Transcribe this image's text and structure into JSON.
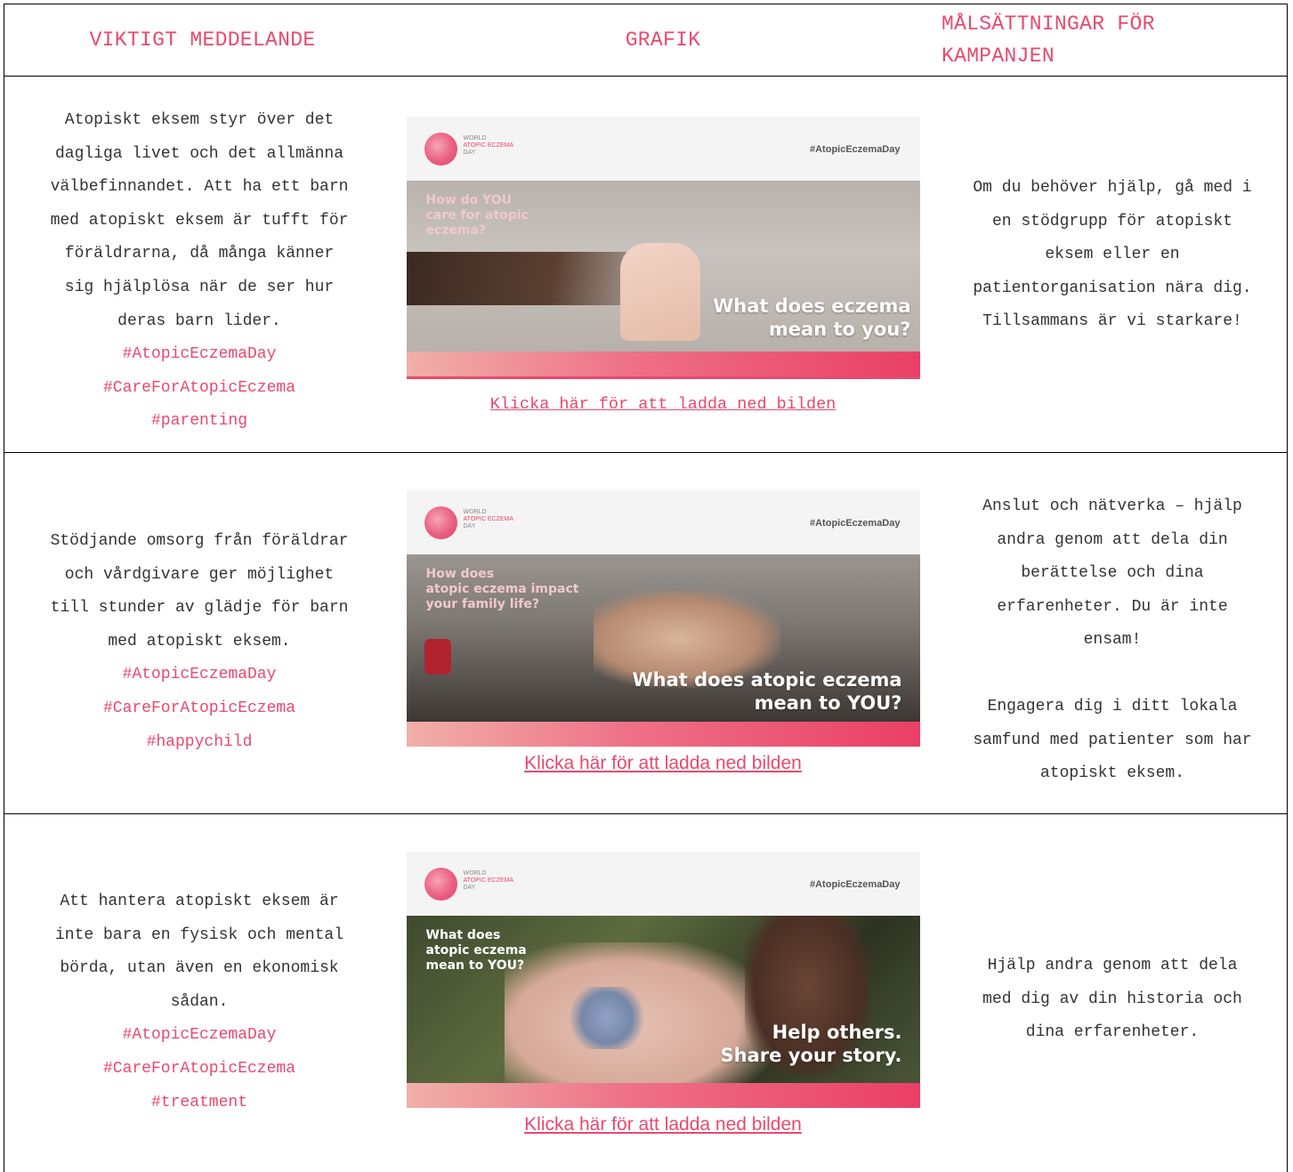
{
  "header": {
    "col1": "VIKTIGT MEDDELANDE",
    "col2": "GRAFIK",
    "col3_line1": "MÅLSÄTTNINGAR FÖR",
    "col3_line2": "KAMPANJEN"
  },
  "rows": [
    {
      "message_lines": [
        "Atopiskt eksem styr över det",
        "dagliga livet och det allmänna",
        "välbefinnandet. Att ha ett barn",
        "med atopiskt eksem är tufft för",
        "föräldrarna, då många känner",
        "sig hjälplösa när de ser hur",
        "deras barn lider."
      ],
      "hashtags": [
        "#AtopicEczemaDay",
        "#CareForAtopicEczema",
        "#parenting"
      ],
      "graphic": {
        "logo_text": [
          "WORLD",
          "ATOPIC ECZEMA",
          "DAY"
        ],
        "hashtag": "#AtopicEczemaDay",
        "question": "How do YOU\ncare for atopic\neczema?",
        "headline": "What does eczema\nmean to you?"
      },
      "link": "Klicka här för att ladda ned bilden",
      "goal_lines": [
        "Om du behöver hjälp, gå med i",
        "en stödgrupp för atopiskt",
        "eksem eller en",
        "patientorganisation nära dig.",
        "Tillsammans är vi starkare!"
      ]
    },
    {
      "message_lines": [
        "Stödjande omsorg från föräldrar",
        "och vårdgivare ger möjlighet",
        "till stunder av glädje för barn",
        "med atopiskt eksem."
      ],
      "hashtags": [
        "#AtopicEczemaDay",
        "#CareForAtopicEczema",
        "#happychild"
      ],
      "graphic": {
        "logo_text": [
          "WORLD",
          "ATOPIC ECZEMA",
          "DAY"
        ],
        "hashtag": "#AtopicEczemaDay",
        "question": "How does\natopic eczema impact\nyour family life?",
        "headline": "What does atopic eczema\nmean to YOU?"
      },
      "link": "Klicka här för att ladda ned bilden",
      "goal_lines": [
        "Anslut och nätverka – hjälp",
        "andra genom att dela din",
        "berättelse och dina",
        "erfarenheter. Du är inte",
        "ensam!"
      ],
      "goal_lines_2": [
        "Engagera dig i ditt lokala",
        "samfund med patienter som har",
        "atopiskt eksem."
      ]
    },
    {
      "message_lines": [
        "Att hantera atopiskt eksem är",
        "inte bara en fysisk och mental",
        "börda, utan även en ekonomisk",
        "sådan."
      ],
      "hashtags": [
        "#AtopicEczemaDay",
        "#CareForAtopicEczema",
        "#treatment"
      ],
      "graphic": {
        "logo_text": [
          "WORLD",
          "ATOPIC ECZEMA",
          "DAY"
        ],
        "hashtag": "#AtopicEczemaDay",
        "question": "What does\natopic eczema\nmean to YOU?",
        "headline": "Help others.\nShare your story."
      },
      "link": "Klicka här för att ladda ned bilden",
      "goal_lines": [
        "Hjälp andra genom att dela",
        "med dig av din historia och",
        "dina erfarenheter."
      ]
    }
  ]
}
